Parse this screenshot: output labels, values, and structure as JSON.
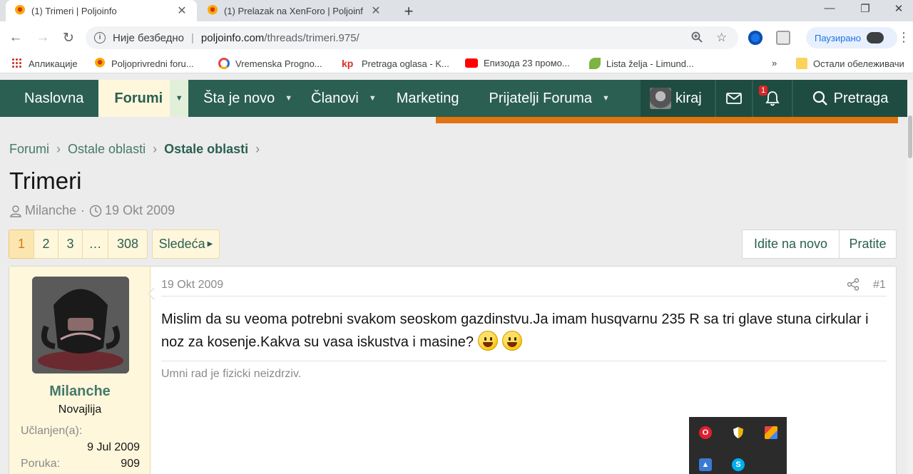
{
  "browser": {
    "tabs": [
      {
        "title": "(1) Trimeri | Poljoinfo",
        "active": true
      },
      {
        "title": "(1) Prelazak na XenForo | Poljoinf",
        "active": false
      }
    ],
    "new_tab": "+",
    "omnibox": {
      "security_label": "Није безбедно",
      "url_host": "poljoinfo.com",
      "url_path": "/threads/trimeri.975/"
    },
    "profile_label": "Паузирано",
    "bookmarks": [
      {
        "label": "Апликације"
      },
      {
        "label": "Poljoprivredni foru..."
      },
      {
        "label": "Vremenska Progno..."
      },
      {
        "label": "Pretraga oglasa - K..."
      },
      {
        "label": "Епизода 23 промо..."
      },
      {
        "label": "Lista želja - Limund..."
      },
      {
        "label": "Остали обележивачи"
      }
    ],
    "bookmarks_overflow": "»"
  },
  "forum_nav": {
    "items": [
      {
        "label": "Naslovna"
      },
      {
        "label": "Forumi"
      },
      {
        "label": "Šta je novo"
      },
      {
        "label": "Članovi"
      },
      {
        "label": "Marketing"
      },
      {
        "label": "Prijatelji Foruma"
      }
    ],
    "username": "kiraj",
    "alerts_count": "1",
    "search_label": "Pretraga"
  },
  "breadcrumb": [
    "Forumi",
    "Ostale oblasti",
    "Ostale oblasti"
  ],
  "thread": {
    "title": "Trimeri",
    "author": "Milanche",
    "date": "19 Okt 2009"
  },
  "pagination": {
    "pages": [
      "1",
      "2",
      "3",
      "…",
      "308"
    ],
    "current": "1",
    "next_label": "Sledeća"
  },
  "actions": {
    "unread_label": "Idite na novo",
    "watch_label": "Pratite"
  },
  "post": {
    "date": "19 Okt 2009",
    "number": "#1",
    "body": "Mislim da su veoma potrebni svakom seoskom gazdinstvu.Ja imam husqvarnu 235 R sa tri glave stuna cirkular i noz za kosenje.Kakva su vasa iskustva i masine?",
    "signature": "Umni rad je fizicki neizdrziv.",
    "user": {
      "name": "Milanche",
      "title": "Novajlija",
      "joined_label": "Učlanjen(a):",
      "joined_value": "9 Jul 2009",
      "posts_label": "Poruka:",
      "posts_value": "909"
    }
  },
  "colors": {
    "nav_bg": "#2b5f51",
    "accent_orange": "#e07410",
    "link_green": "#45796a",
    "pager_bg": "#fef7dc"
  }
}
